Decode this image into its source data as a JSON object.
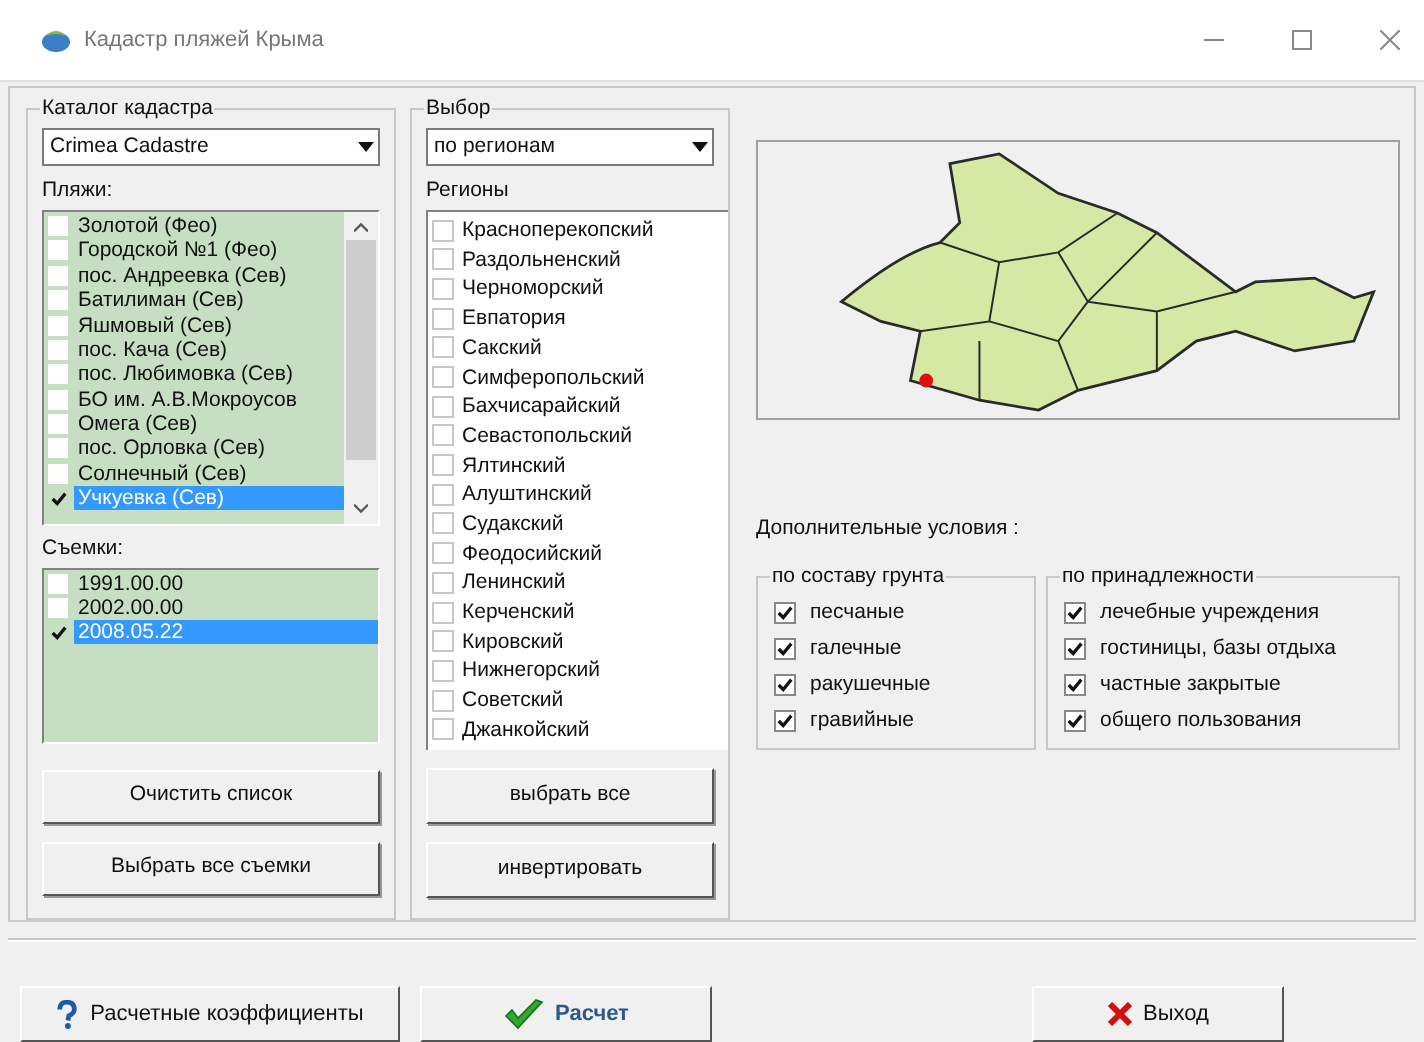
{
  "window": {
    "title": "Кадастр пляжей Крыма"
  },
  "catalog": {
    "title": "Каталог кадастра",
    "combo": "Crimea Cadastre",
    "beaches": {
      "label": "Пляжи:",
      "items": [
        {
          "label": "Золотой (Фео)",
          "checked": false,
          "selected": false
        },
        {
          "label": "Городской №1 (Фео)",
          "checked": false,
          "selected": false
        },
        {
          "label": "пос. Андреевка (Сев)",
          "checked": false,
          "selected": false
        },
        {
          "label": "Батилиман (Сев)",
          "checked": false,
          "selected": false
        },
        {
          "label": "Яшмовый (Сев)",
          "checked": false,
          "selected": false
        },
        {
          "label": "пос. Кача (Сев)",
          "checked": false,
          "selected": false
        },
        {
          "label": "пос. Любимовка (Сев)",
          "checked": false,
          "selected": false
        },
        {
          "label": "БО им. А.В.Мокроусов",
          "checked": false,
          "selected": false
        },
        {
          "label": "Омега (Сев)",
          "checked": false,
          "selected": false
        },
        {
          "label": "пос. Орловка (Сев)",
          "checked": false,
          "selected": false
        },
        {
          "label": "Солнечный (Сев)",
          "checked": false,
          "selected": false
        },
        {
          "label": "Учкуевка (Сев)",
          "checked": true,
          "selected": true
        }
      ]
    },
    "surveys": {
      "label": "Съемки:",
      "items": [
        {
          "label": "1991.00.00",
          "checked": false,
          "selected": false
        },
        {
          "label": "2002.00.00",
          "checked": false,
          "selected": false
        },
        {
          "label": "2008.05.22",
          "checked": true,
          "selected": true
        }
      ]
    },
    "buttons": [
      "Очистить список",
      "Выбрать все съемки"
    ]
  },
  "selection": {
    "title": "Выбор",
    "combo": "по регионам",
    "regions_label": "Регионы",
    "regions": [
      {
        "label": "Красноперекопский",
        "checked": false
      },
      {
        "label": "Раздольненский",
        "checked": false
      },
      {
        "label": "Черноморский",
        "checked": false
      },
      {
        "label": "Евпатория",
        "checked": false
      },
      {
        "label": "Сакский",
        "checked": false
      },
      {
        "label": "Симферопольский",
        "checked": false
      },
      {
        "label": "Бахчисарайский",
        "checked": false
      },
      {
        "label": "Севастопольский",
        "checked": false
      },
      {
        "label": "Ялтинский",
        "checked": false
      },
      {
        "label": "Алуштинский",
        "checked": false
      },
      {
        "label": "Судакский",
        "checked": false
      },
      {
        "label": "Феодосийский",
        "checked": false
      },
      {
        "label": "Ленинский",
        "checked": false
      },
      {
        "label": "Керченский",
        "checked": false
      },
      {
        "label": "Кировский",
        "checked": false
      },
      {
        "label": "Нижнегорский",
        "checked": false
      },
      {
        "label": "Советский",
        "checked": false
      },
      {
        "label": "Джанкойский",
        "checked": false
      }
    ],
    "buttons": [
      "выбрать все",
      "инвертировать"
    ]
  },
  "conditions": {
    "label": "Дополнительные условия :",
    "groups": [
      {
        "title": "по составу грунта",
        "items": [
          {
            "label": "песчаные",
            "checked": true
          },
          {
            "label": "галечные",
            "checked": true
          },
          {
            "label": "ракушечные",
            "checked": true
          },
          {
            "label": "гравийные",
            "checked": true
          }
        ]
      },
      {
        "title": "по принадлежности",
        "items": [
          {
            "label": "лечебные учреждения",
            "checked": true
          },
          {
            "label": "гостиницы, базы отдыха",
            "checked": true
          },
          {
            "label": "частные закрытые",
            "checked": true
          },
          {
            "label": "общего пользования",
            "checked": true
          }
        ]
      }
    ]
  },
  "footer": [
    {
      "label": "Расчетные коэффициенты",
      "kind": "help"
    },
    {
      "label": "Расчет",
      "kind": "run"
    },
    {
      "label": "Выход",
      "kind": "exit"
    }
  ]
}
